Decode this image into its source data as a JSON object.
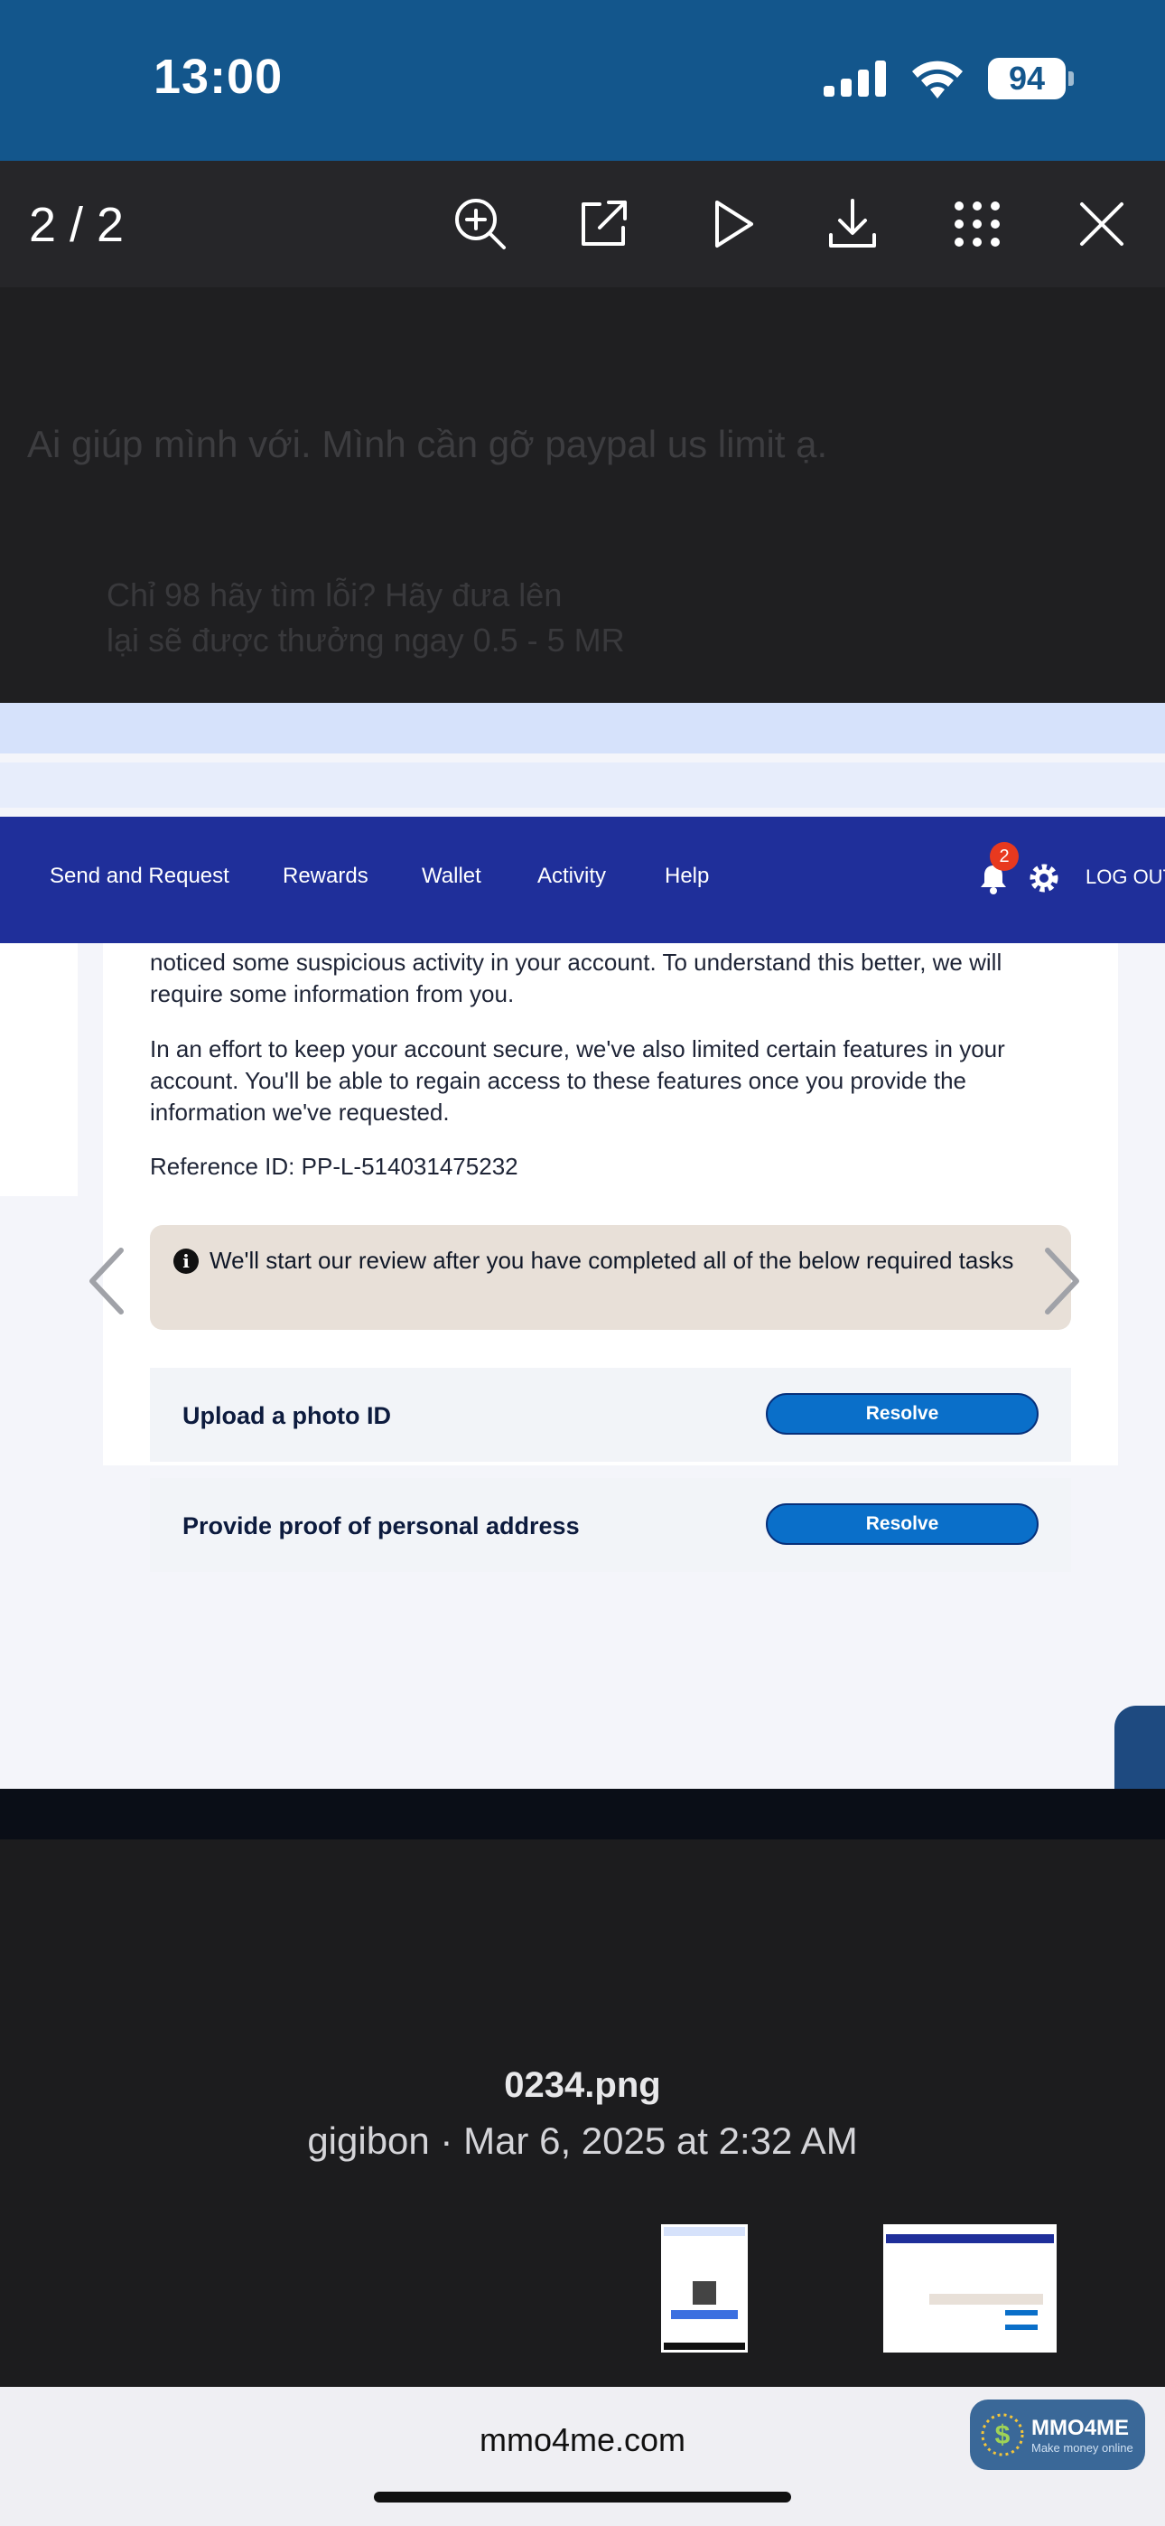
{
  "status_bar": {
    "time": "13:00",
    "battery": "94"
  },
  "viewer": {
    "page_counter": "2 / 2"
  },
  "background_page": {
    "title": "Ai giúp mình với. Mình cần gỡ paypal us limit ạ.",
    "line1": "Chỉ 98 hãy tìm lỗi? Hãy đưa lên",
    "line2": "lại sẽ được thưởng ngay 0.5 - 5 MR"
  },
  "screenshot": {
    "nav": [
      "Send and Request",
      "Rewards",
      "Wallet",
      "Activity",
      "Help"
    ],
    "notification_count": "2",
    "logout": "LOG OUT",
    "paragraph1": "noticed some suspicious activity in your account. To understand this better, we will require some information from you.",
    "paragraph2": "In an effort to keep your account secure, we've also limited certain features in your account. You'll be able to regain access to these features once you provide the information we've requested.",
    "reference": "Reference ID: PP-L-514031475232",
    "alert": "We'll start our review after you have completed all of the below required tasks",
    "tasks": [
      {
        "label": "Upload a photo ID",
        "button": "Resolve"
      },
      {
        "label": "Provide proof of personal address",
        "button": "Resolve"
      }
    ]
  },
  "caption": {
    "file_name": "0234.png",
    "meta": "gigibon · Mar 6, 2025 at 2:32 AM"
  },
  "browser": {
    "url": "mmo4me.com",
    "logo_name": "MMO4ME",
    "logo_tagline": "Make money online"
  },
  "colors": {
    "status_bar": "#13568c",
    "paypal_nav": "#1f2f9a",
    "resolve_button": "#0a6fc9",
    "alert_bg": "#e8e0d8"
  }
}
